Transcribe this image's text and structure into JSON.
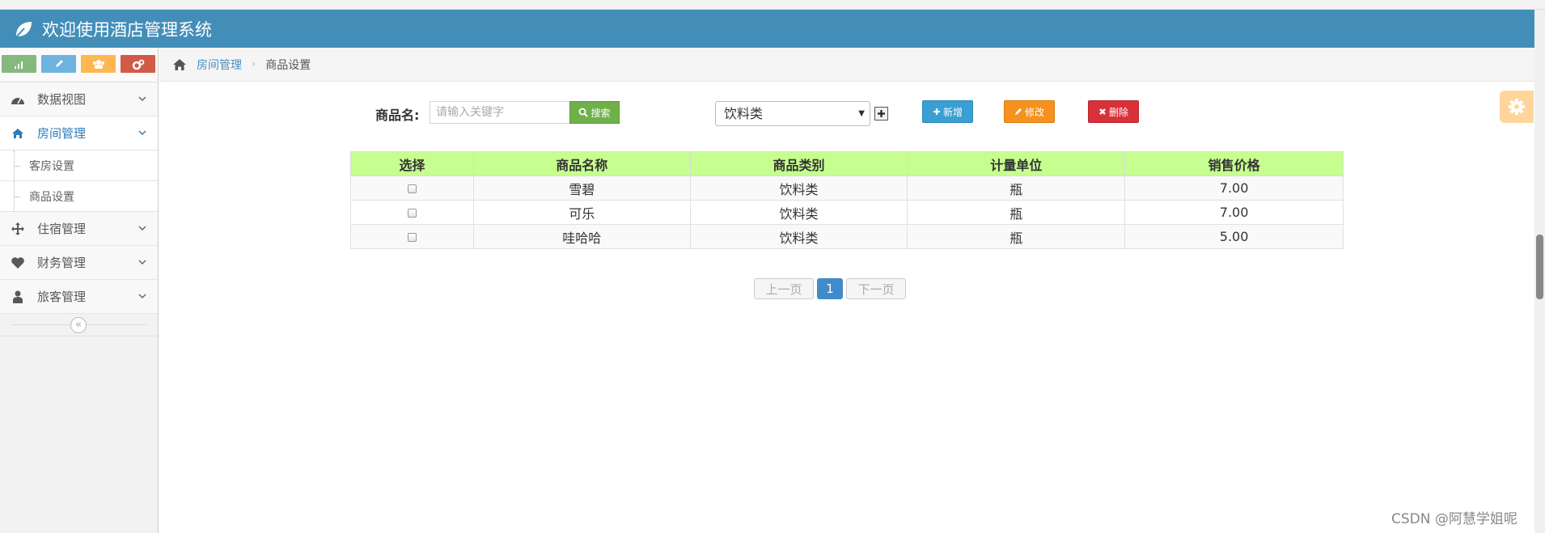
{
  "header": {
    "title": "欢迎使用酒店管理系统"
  },
  "sidebar": {
    "shortcuts": [
      {
        "icon": "signal-icon",
        "color": "#87b87f"
      },
      {
        "icon": "pencil-icon",
        "color": "#6fb3e0"
      },
      {
        "icon": "users-icon",
        "color": "#ffb752"
      },
      {
        "icon": "cogs-icon",
        "color": "#d15b47"
      }
    ],
    "items": [
      {
        "label": "数据视图",
        "icon": "dashboard-icon"
      },
      {
        "label": "房间管理",
        "icon": "home-icon",
        "active": true,
        "children": [
          "客房设置",
          "商品设置"
        ]
      },
      {
        "label": "住宿管理",
        "icon": "move-arrows-icon"
      },
      {
        "label": "财务管理",
        "icon": "heart-icon"
      },
      {
        "label": "旅客管理",
        "icon": "user-icon"
      }
    ],
    "collapse_glyph": "«"
  },
  "breadcrumb": {
    "parent": "房间管理",
    "current": "商品设置",
    "separator": "›"
  },
  "toolbar": {
    "search_label": "商品名:",
    "search_placeholder": "请输入关键字",
    "search_button": "搜索",
    "category_selected": "饮料类",
    "add_button": "新增",
    "edit_button": "修改",
    "delete_button": "删除"
  },
  "table": {
    "columns": [
      "选择",
      "商品名称",
      "商品类别",
      "计量单位",
      "销售价格"
    ],
    "rows": [
      {
        "name": "雪碧",
        "category": "饮料类",
        "unit": "瓶",
        "price": "7.00"
      },
      {
        "name": "可乐",
        "category": "饮料类",
        "unit": "瓶",
        "price": "7.00"
      },
      {
        "name": "哇哈哈",
        "category": "饮料类",
        "unit": "瓶",
        "price": "5.00"
      }
    ]
  },
  "pagination": {
    "prev": "上一页",
    "current": "1",
    "next": "下一页"
  },
  "watermark": "CSDN @阿慧学姐呢",
  "colors": {
    "header": "#438eb9",
    "table_header": "#c6ff8f",
    "search": "#6fb04a",
    "add": "#3a9fd4",
    "edit": "#f5911c",
    "delete": "#d9313a",
    "page": "#428bca"
  }
}
